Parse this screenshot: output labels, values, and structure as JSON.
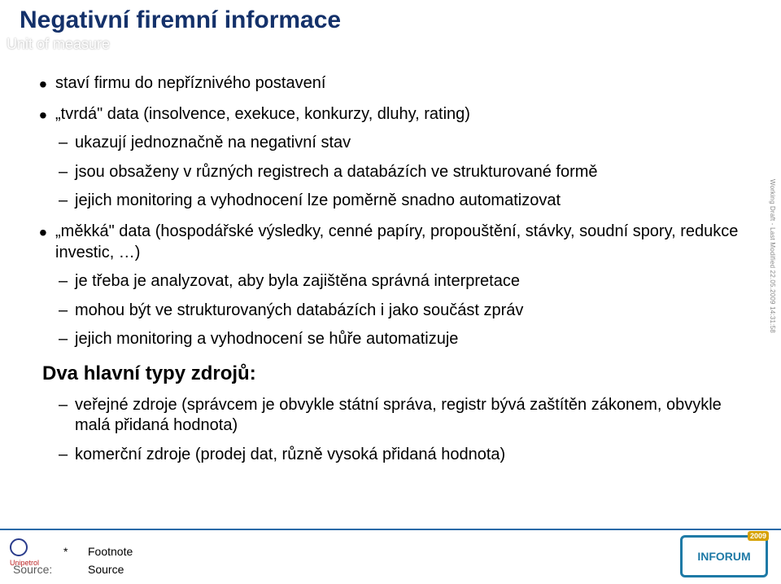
{
  "title": "Negativní firemní informace",
  "unit_of_measure": "Unit of measure",
  "side_stamp": "Working Draft - Last Modified 22.05.2009 14:31:58",
  "bullets": {
    "b1_1": "staví firmu do nepříznivého postavení",
    "b1_2": "„tvrdá\" data (insolvence, exekuce, konkurzy, dluhy, rating)",
    "b2_1": "ukazují jednoznačně na negativní stav",
    "b2_2": "jsou obsaženy v různých registrech a databázích ve strukturované formě",
    "b2_3": "jejich monitoring a vyhodnocení lze poměrně snadno automatizovat",
    "b1_3": "„měkká\" data (hospodářské výsledky, cenné papíry, propouštění, stávky, soudní spory, redukce investic, …)",
    "b2_4": "je třeba je analyzovat, aby byla zajištěna správná interpretace",
    "b2_5": "mohou být ve strukturovaných databázích i jako součást zpráv",
    "b2_6": "jejich monitoring a vyhodnocení se hůře automatizuje",
    "heading": "Dva hlavní typy zdrojů:",
    "b2_7": "veřejné zdroje (správcem je obvykle státní správa, registr bývá zaštítěn zákonem, obvykle malá přidaná hodnota)",
    "b2_8": "komerční zdroje (prodej dat, různě vysoká přidaná hodnota)"
  },
  "footer": {
    "star": "*",
    "footnote": "Footnote",
    "source_label": "Source:",
    "source_value": "Source"
  },
  "logos": {
    "left_label": "Unipetrol",
    "right_label": "INFORUM",
    "right_badge": "2009"
  }
}
